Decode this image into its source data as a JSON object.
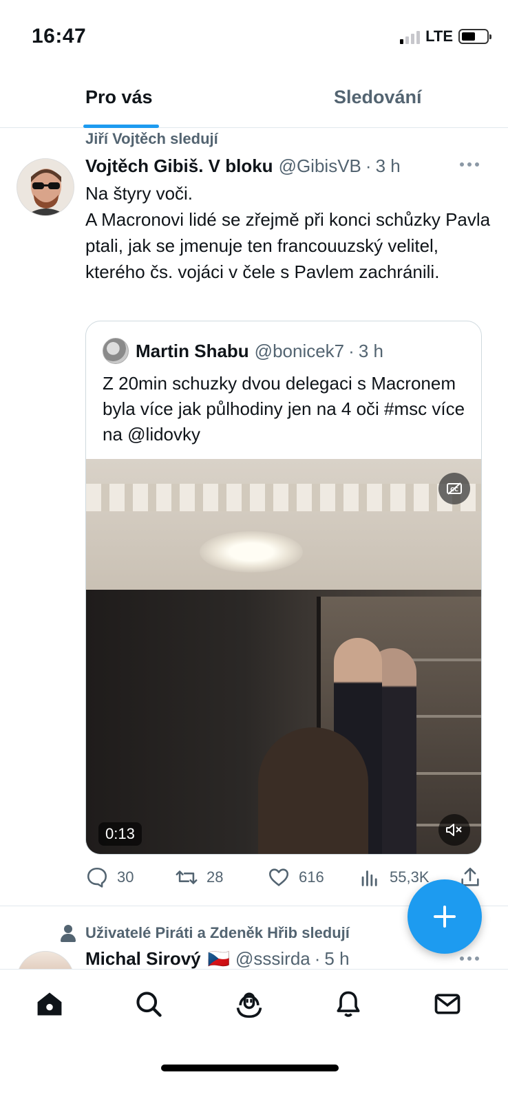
{
  "status_bar": {
    "time": "16:47",
    "network": "LTE",
    "battery_level": 0.55,
    "signal_bars_on": 1
  },
  "tabs": [
    {
      "label": "Pro vás",
      "active": true
    },
    {
      "label": "Sledování",
      "active": false
    }
  ],
  "tweet1": {
    "social_context": "Jiří Vojtěch sledují",
    "author_name": "Vojtěch Gibiš. V bloku",
    "handle": "@GibisVB",
    "separator": "·",
    "time": "3 h",
    "text": "Na štyry voči.\nA Macronovi lidé se zřejmě při konci schůzky Pavla ptali, jak se jmenuje ten francouuzský velitel, kterého čs. vojáci v čele s Pavlem zachránili.",
    "quote": {
      "author_name": "Martin Shabu",
      "handle": "@bonicek7",
      "separator": "·",
      "time": "3 h",
      "text": "Z 20min schuzky dvou delegaci s Macronem byla více jak půlhodiny jen na 4 oči #msc více na @lidovky",
      "video_duration": "0:13"
    },
    "stats": {
      "replies": "30",
      "retweets": "28",
      "likes": "616",
      "views": "55,3K"
    }
  },
  "tweet2": {
    "social_context": "Uživatelé Piráti a Zdeněk Hřib sledují",
    "author_name": "Michal Sirový",
    "flag": "🇨🇿",
    "handle": "@sssirda",
    "separator": "·",
    "time": "5 h"
  },
  "colors": {
    "accent": "#1d9bf0",
    "secondary_text": "#536471",
    "primary_text": "#0f1419"
  },
  "icons": [
    "home-icon",
    "search-icon",
    "spaces-icon",
    "notifications-icon",
    "messages-icon",
    "compose-plus-icon"
  ]
}
